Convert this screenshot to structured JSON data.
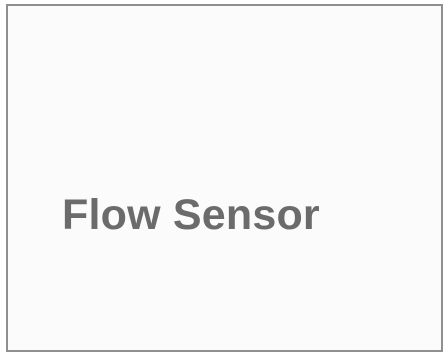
{
  "panel": {
    "label": "Flow Sensor"
  },
  "colors": {
    "border": "#8f8f8f",
    "background": "#fbfbfb",
    "text": "#6b6b6b"
  }
}
